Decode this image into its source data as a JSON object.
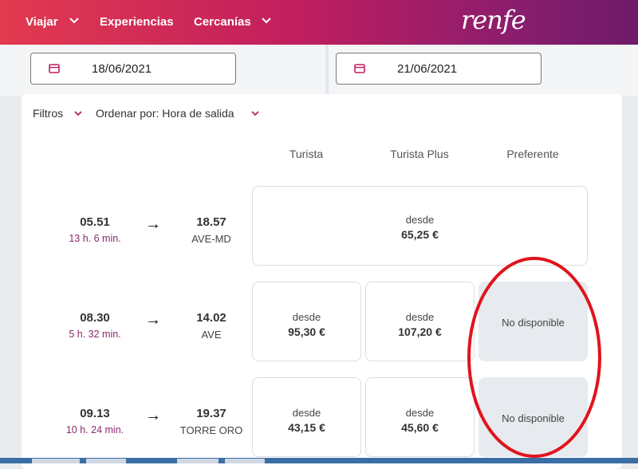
{
  "nav": {
    "viajar": "Viajar",
    "experiencias": "Experiencias",
    "cercanias": "Cercanías",
    "logo": "renfe"
  },
  "dates": {
    "ida": "18/06/2021",
    "vuelta": "21/06/2021"
  },
  "filters": {
    "filtros": "Filtros",
    "ordenar": "Ordenar por: Hora de salida"
  },
  "columns": [
    "Turista",
    "Turista Plus",
    "Preferente"
  ],
  "trains": [
    {
      "departure": "05.51",
      "duration": "13 h. 6 min.",
      "arrival": "18.57",
      "train": "AVE-MD",
      "single_fare": {
        "desde": "desde",
        "price": "65,25 €"
      }
    },
    {
      "departure": "08.30",
      "duration": "5 h. 32 min.",
      "arrival": "14.02",
      "train": "AVE",
      "fares": [
        {
          "desde": "desde",
          "price": "95,30 €"
        },
        {
          "desde": "desde",
          "price": "107,20 €"
        },
        {
          "status": "No disponible"
        }
      ]
    },
    {
      "departure": "09.13",
      "duration": "10 h. 24 min.",
      "arrival": "19.37",
      "train": "TORRE ORO",
      "fares": [
        {
          "desde": "desde",
          "price": "43,15 €"
        },
        {
          "desde": "desde",
          "price": "45,60 €"
        },
        {
          "status": "No disponible"
        }
      ]
    }
  ],
  "icons": {
    "calendar": "calendar-icon",
    "chevron": "chevron-down-icon",
    "arrow": "arrow-right-icon"
  },
  "colors": {
    "accent": "#c21f5e",
    "duration": "#8a2a6e",
    "annotation": "#e0141c"
  }
}
